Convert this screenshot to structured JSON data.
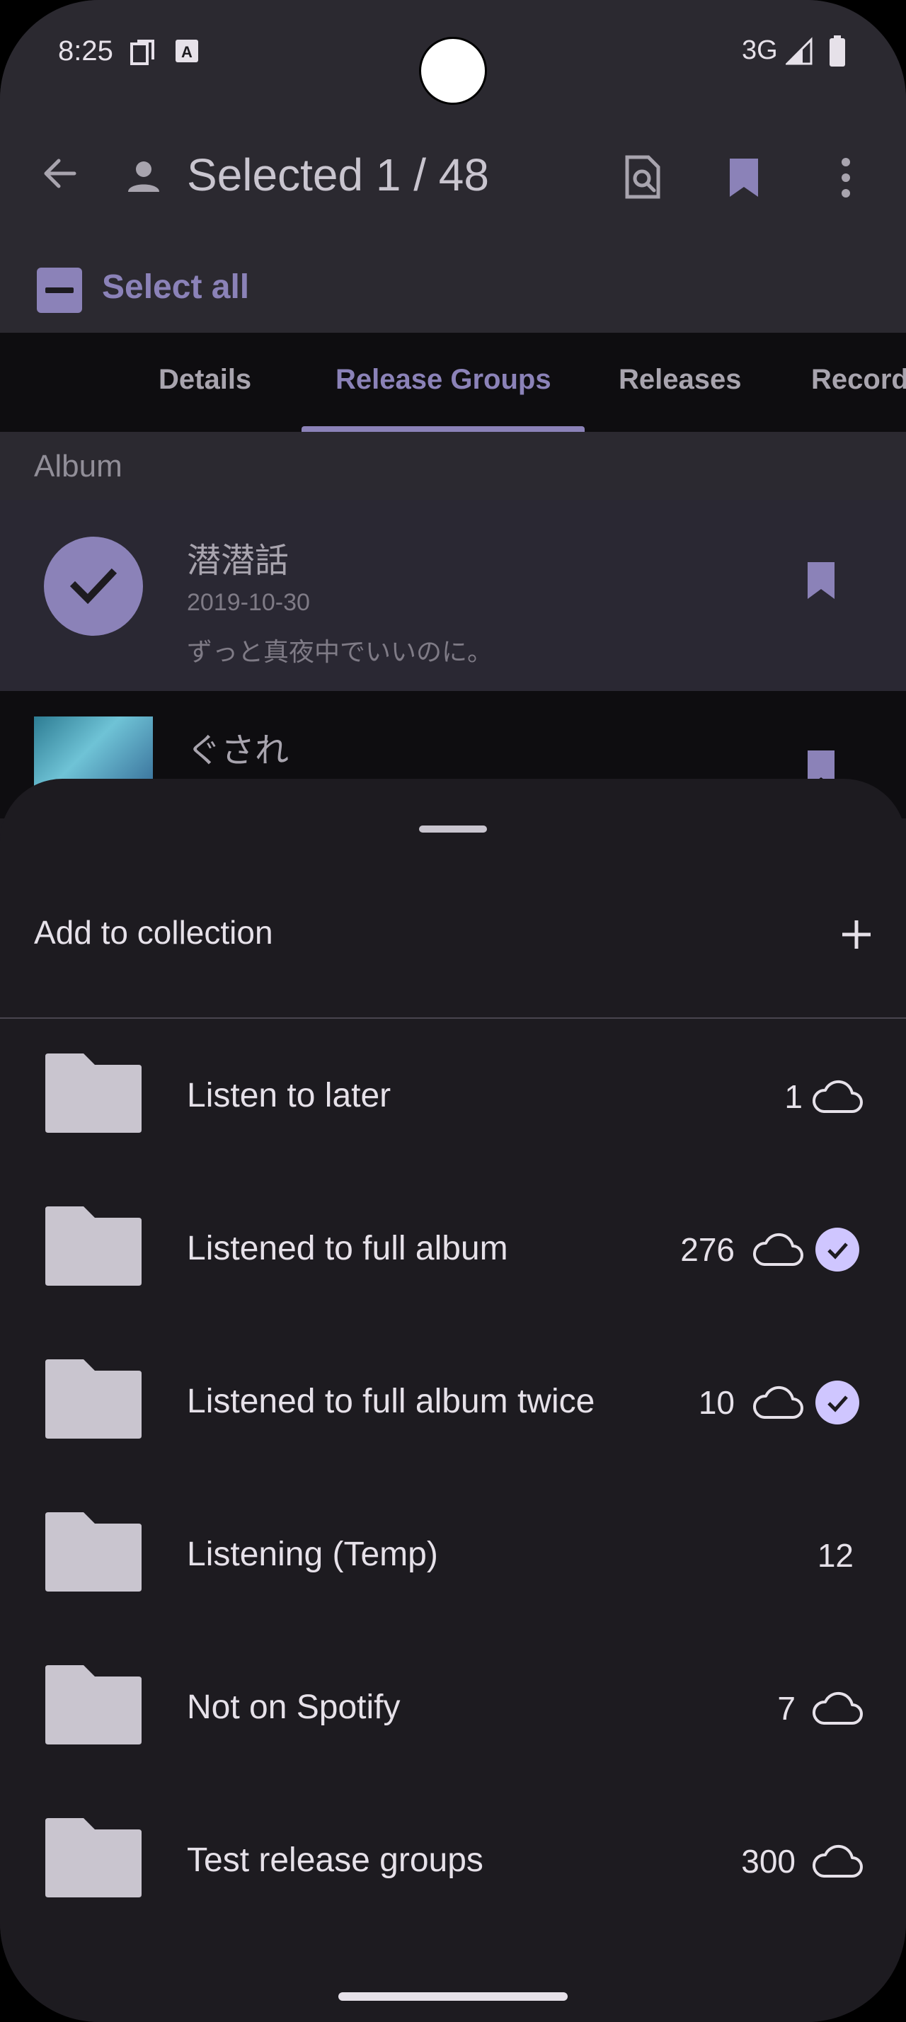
{
  "status_bar": {
    "time": "8:25",
    "network": "3G"
  },
  "app_bar": {
    "title": "Selected 1 / 48",
    "select_all_label": "Select all"
  },
  "tabs": [
    {
      "label": "Details",
      "active": false
    },
    {
      "label": "Release Groups",
      "active": true
    },
    {
      "label": "Releases",
      "active": false
    },
    {
      "label": "Record",
      "active": false
    }
  ],
  "list": {
    "section_header": "Album",
    "rows": [
      {
        "title": "潜潜話",
        "date": "2019-10-30",
        "artist": "ずっと真夜中でいいのに。",
        "selected": true
      },
      {
        "title": "ぐされ"
      }
    ]
  },
  "sheet": {
    "title": "Add to collection",
    "collections": [
      {
        "name": "Listen to later",
        "count": "1",
        "cloud": true,
        "checked": false
      },
      {
        "name": "Listened to full album",
        "count": "276",
        "cloud": true,
        "checked": true
      },
      {
        "name": "Listened to full album twice",
        "count": "10",
        "cloud": true,
        "checked": true
      },
      {
        "name": "Listening (Temp)",
        "count": "12",
        "cloud": false,
        "checked": false
      },
      {
        "name": "Not on Spotify",
        "count": "7",
        "cloud": true,
        "checked": false
      },
      {
        "name": "Test release groups",
        "count": "300",
        "cloud": true,
        "checked": false
      }
    ]
  },
  "colors": {
    "accent": "#8b82b8",
    "check": "#cfc6ff",
    "sheet_bg": "#1d1b20"
  }
}
